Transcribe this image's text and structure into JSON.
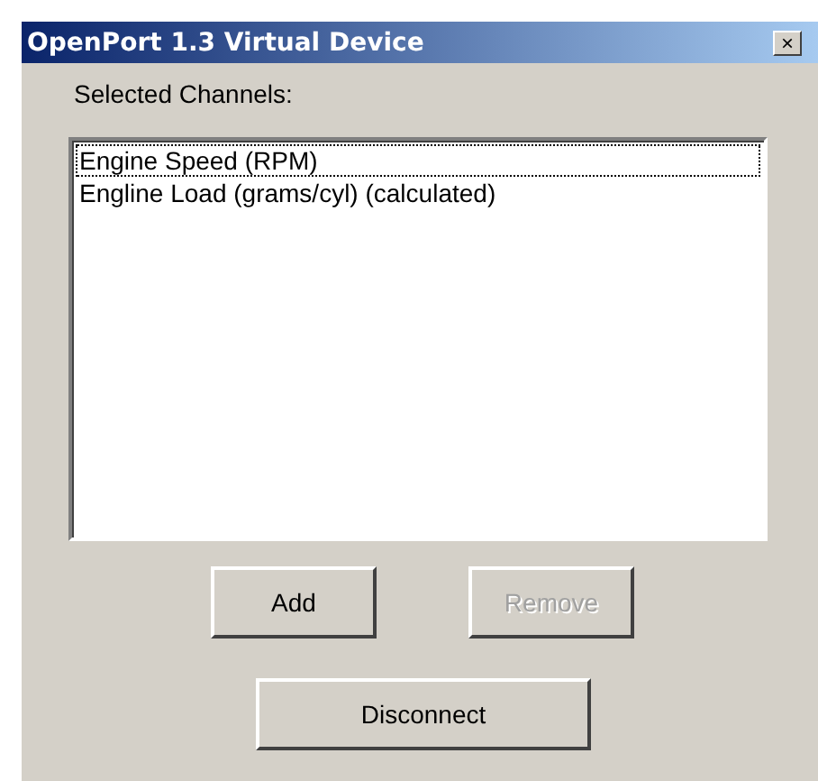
{
  "window": {
    "title": "OpenPort 1.3 Virtual Device",
    "close_label": "×"
  },
  "channels_label": "Selected Channels:",
  "channels": [
    {
      "name": "Engine Speed (RPM)",
      "focused": true
    },
    {
      "name": "Engline Load (grams/cyl) (calculated)",
      "focused": false
    }
  ],
  "buttons": [
    {
      "label": "Add",
      "disabled": false
    },
    {
      "label": "Remove",
      "disabled": true
    }
  ],
  "disconnect_button": {
    "label": "Disconnect",
    "disabled": false
  }
}
